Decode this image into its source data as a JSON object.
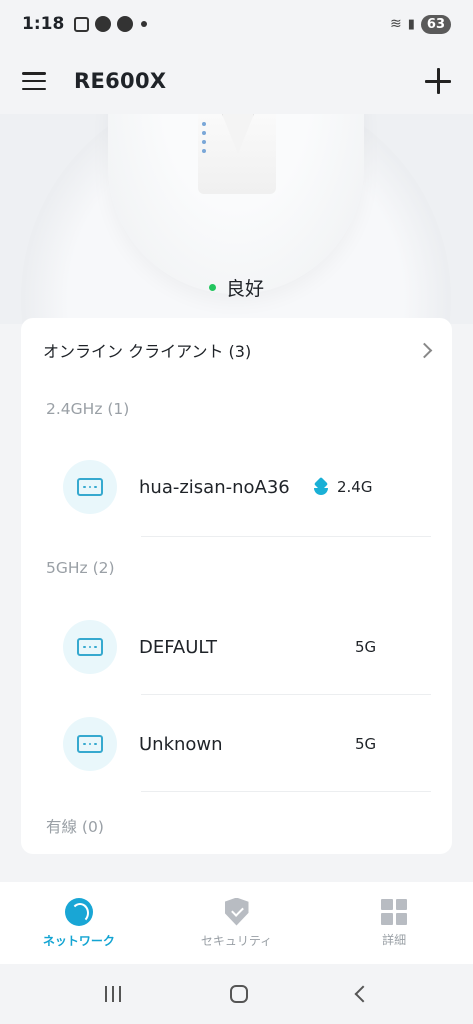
{
  "status_bar": {
    "time": "1:18",
    "battery": "63"
  },
  "header": {
    "title": "RE600X",
    "menu_icon": "hamburger-menu-icon",
    "add_icon": "plus-icon"
  },
  "hero": {
    "status_label": "良好",
    "status_color": "#22c55e"
  },
  "clients_card": {
    "title": "オンライン クライアント (3)",
    "groups": [
      {
        "label": "2.4GHz (1)",
        "clients": [
          {
            "name": "hua-zisan-noA36",
            "band": "2.4G",
            "tag_icon": "mesh-tag-icon"
          }
        ]
      },
      {
        "label": "5GHz (2)",
        "clients": [
          {
            "name": "DEFAULT",
            "band": "5G"
          },
          {
            "name": "Unknown",
            "band": "5G"
          }
        ]
      },
      {
        "label": "有線 (0)",
        "clients": []
      }
    ]
  },
  "bottom_nav": {
    "items": [
      {
        "label": "ネットワーク",
        "icon": "globe-icon",
        "active": true
      },
      {
        "label": "セキュリティ",
        "icon": "shield-icon",
        "active": false
      },
      {
        "label": "詳細",
        "icon": "grid-icon",
        "active": false
      }
    ]
  },
  "colors": {
    "accent": "#13a4d2",
    "client_icon": "#36a9cf"
  }
}
